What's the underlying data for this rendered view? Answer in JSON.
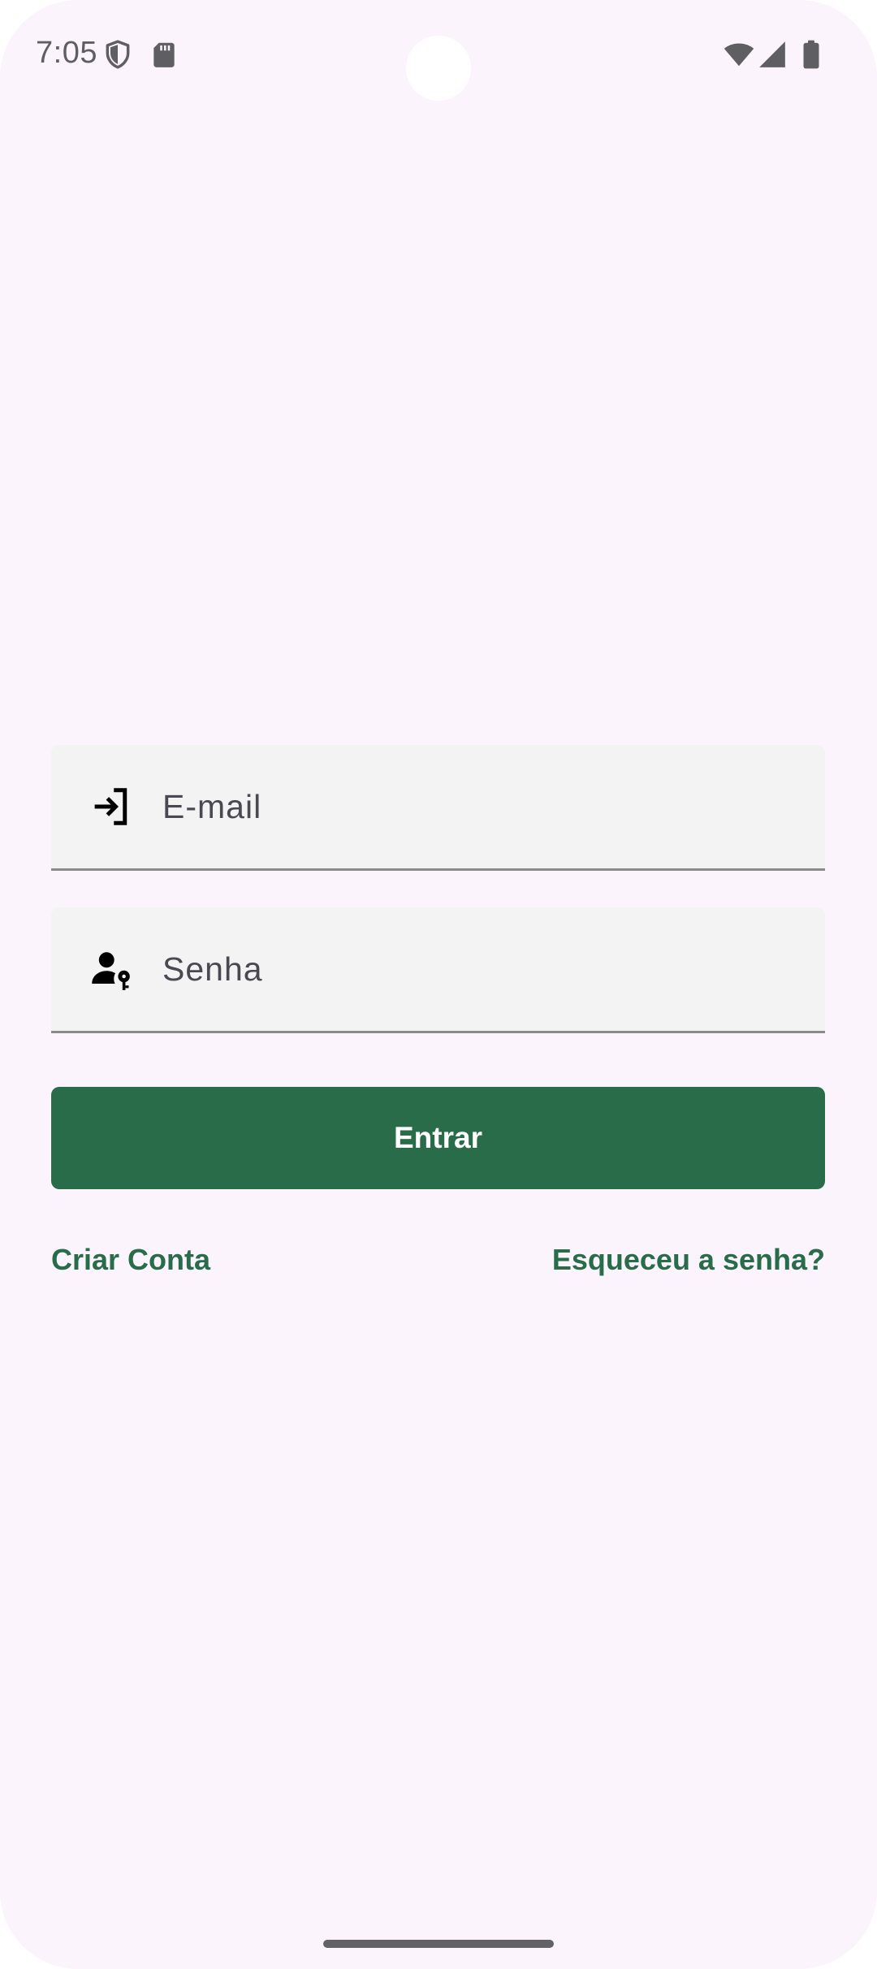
{
  "status_bar": {
    "time": "7:05",
    "icons": [
      "shield-icon",
      "sd-card-icon",
      "wifi-icon",
      "cell-signal-icon",
      "battery-icon"
    ]
  },
  "login_form": {
    "email": {
      "placeholder": "E-mail",
      "value": "",
      "icon": "login-arrow-icon"
    },
    "password": {
      "placeholder": "Senha",
      "value": "",
      "icon": "person-key-icon"
    },
    "submit_label": "Entrar",
    "create_account_label": "Criar Conta",
    "forgot_password_label": "Esqueceu a senha?"
  },
  "colors": {
    "background": "#fcf4fc",
    "field_background": "#f3f3f3",
    "accent": "#286c4a",
    "status_text": "#5f5f63"
  }
}
